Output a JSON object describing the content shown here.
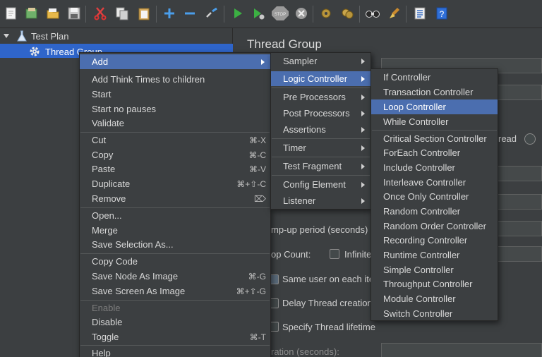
{
  "toolbar": {
    "icons": [
      "new-icon",
      "templates-icon",
      "open-icon",
      "save-icon",
      "cut-icon",
      "copy-icon",
      "paste-icon",
      "expand-icon",
      "collapse-icon",
      "toggle-icon",
      "start-icon",
      "start-no-pauses-icon",
      "stop-icon",
      "shutdown-icon",
      "clear-icon",
      "clear-all-icon",
      "search-icon",
      "reset-search-icon",
      "function-helper-icon",
      "help-icon"
    ]
  },
  "tree": {
    "test_plan": "Test Plan",
    "thread_group": "Thread Group"
  },
  "panel": {
    "title": "Thread Group",
    "thread_label_fragment": "read",
    "rampup_label": "mp-up period (seconds)",
    "loop_label": "op Count:",
    "infinite_label": "Infinite",
    "same_user_label": "Same user on each ite",
    "delay_label": "Delay Thread creation",
    "lifetime_label": "Specify Thread lifetime",
    "duration_label": "ration (seconds):"
  },
  "context_menu": {
    "items": [
      {
        "label": "Add",
        "shortcut": "",
        "submenu": true,
        "selected": true
      },
      {
        "label": "Add Think Times to children",
        "shortcut": ""
      },
      {
        "label": "Start",
        "shortcut": ""
      },
      {
        "label": "Start no pauses",
        "shortcut": ""
      },
      {
        "label": "Validate",
        "shortcut": ""
      },
      {
        "label": "Cut",
        "shortcut": "⌘-X"
      },
      {
        "label": "Copy",
        "shortcut": "⌘-C"
      },
      {
        "label": "Paste",
        "shortcut": "⌘-V"
      },
      {
        "label": "Duplicate",
        "shortcut": "⌘+⇧-C"
      },
      {
        "label": "Remove",
        "shortcut": "⌦"
      },
      {
        "label": "Open...",
        "shortcut": ""
      },
      {
        "label": "Merge",
        "shortcut": ""
      },
      {
        "label": "Save Selection As...",
        "shortcut": ""
      },
      {
        "label": "Copy Code",
        "shortcut": ""
      },
      {
        "label": "Save Node As Image",
        "shortcut": "⌘-G"
      },
      {
        "label": "Save Screen As Image",
        "shortcut": "⌘+⇧-G"
      },
      {
        "label": "Enable",
        "shortcut": "",
        "disabled": true
      },
      {
        "label": "Disable",
        "shortcut": ""
      },
      {
        "label": "Toggle",
        "shortcut": "⌘-T"
      },
      {
        "label": "Help",
        "shortcut": ""
      }
    ]
  },
  "add_menu": {
    "items": [
      {
        "label": "Sampler"
      },
      {
        "label": "Logic Controller",
        "selected": true
      },
      {
        "label": "Pre Processors"
      },
      {
        "label": "Post Processors"
      },
      {
        "label": "Assertions"
      },
      {
        "label": "Timer"
      },
      {
        "label": "Test Fragment"
      },
      {
        "label": "Config Element"
      },
      {
        "label": "Listener"
      }
    ]
  },
  "logic_menu": {
    "items": [
      {
        "label": "If Controller"
      },
      {
        "label": "Transaction Controller"
      },
      {
        "label": "Loop Controller",
        "selected": true
      },
      {
        "label": "While Controller"
      },
      {
        "label": "Critical Section Controller"
      },
      {
        "label": "ForEach Controller"
      },
      {
        "label": "Include Controller"
      },
      {
        "label": "Interleave Controller"
      },
      {
        "label": "Once Only Controller"
      },
      {
        "label": "Random Controller"
      },
      {
        "label": "Random Order Controller"
      },
      {
        "label": "Recording Controller"
      },
      {
        "label": "Runtime Controller"
      },
      {
        "label": "Simple Controller"
      },
      {
        "label": "Throughput Controller"
      },
      {
        "label": "Module Controller"
      },
      {
        "label": "Switch Controller"
      }
    ]
  }
}
